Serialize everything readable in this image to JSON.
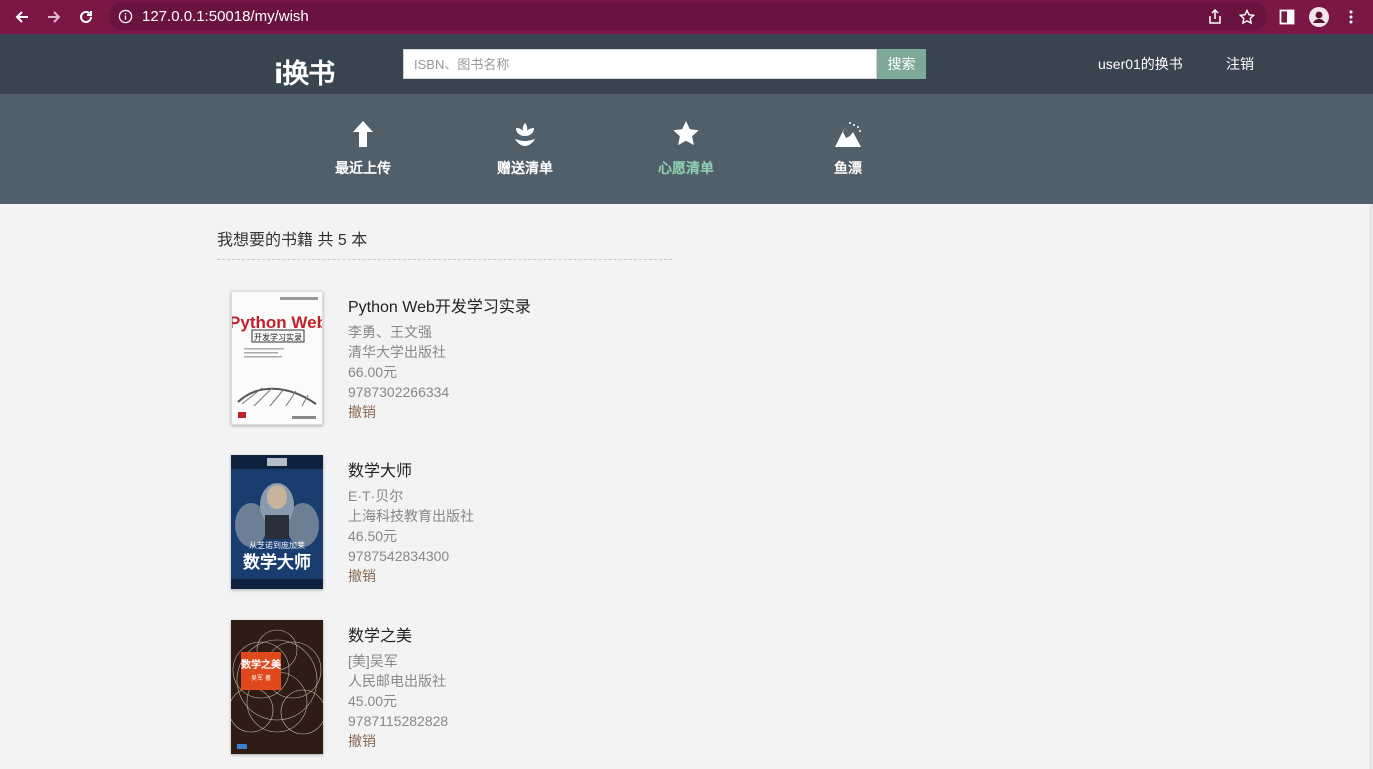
{
  "browser": {
    "url": "127.0.0.1:50018/my/wish",
    "icons": [
      "back-arrow-icon",
      "forward-arrow-icon",
      "reload-icon",
      "info-icon",
      "share-icon",
      "bookmark-star-icon",
      "sidebar-icon",
      "profile-icon",
      "kebab-menu-icon"
    ]
  },
  "header": {
    "logo": "i换书",
    "search_placeholder": "ISBN、图书名称",
    "search_button": "搜索",
    "user_link": "user01的换书",
    "logout": "注销"
  },
  "nav": {
    "items": [
      {
        "label": "最近上传",
        "icon": "arrow-up-icon",
        "active": false
      },
      {
        "label": "赠送清单",
        "icon": "flower-icon",
        "active": false
      },
      {
        "label": "心愿清单",
        "icon": "star-icon",
        "active": true
      },
      {
        "label": "鱼漂",
        "icon": "mountain-icon",
        "active": false
      }
    ],
    "active_color": "#8fd3b4"
  },
  "content": {
    "heading": "我想要的书籍 共 5 本",
    "books": [
      {
        "title": "Python Web开发学习实录",
        "author": "李勇、王文强",
        "publisher": "清华大学出版社",
        "price": "66.00元",
        "isbn": "9787302266334",
        "action": "撤销",
        "cover_title": "Python Web",
        "cover_sub": "开发学习实录"
      },
      {
        "title": "数学大师",
        "author": "E·T·贝尔",
        "publisher": "上海科技教育出版社",
        "price": "46.50元",
        "isbn": "9787542834300",
        "action": "撤销",
        "cover_title": "数学大师",
        "cover_sub": "从芝诺到庞加莱"
      },
      {
        "title": "数学之美",
        "author": "[美]吴军",
        "publisher": "人民邮电出版社",
        "price": "45.00元",
        "isbn": "9787115282828",
        "action": "撤销",
        "cover_title": "数学之美",
        "cover_sub": "吴军 著"
      }
    ]
  },
  "colors": {
    "browser_bar": "#7b1746",
    "header_bg": "#384450",
    "nav_bg": "#515f6b",
    "search_button_bg": "#7ea89a",
    "page_bg": "#f3f3f4"
  }
}
